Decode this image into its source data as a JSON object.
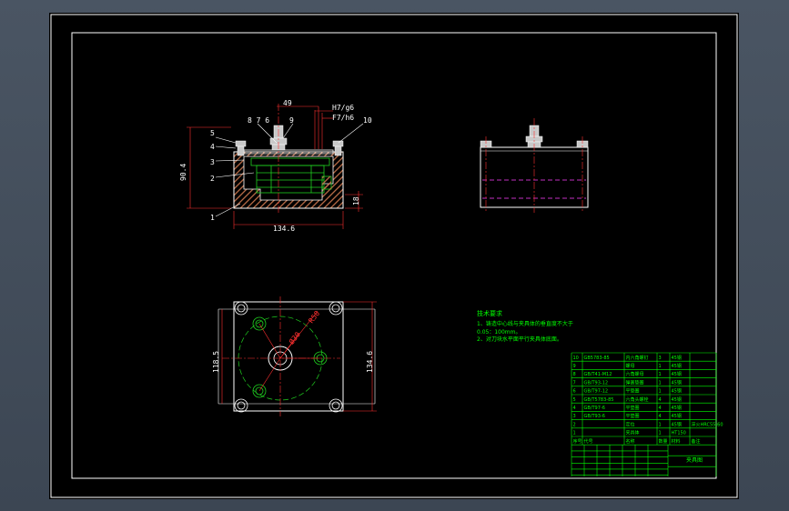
{
  "colors": {
    "background": "#4a5563",
    "sheet": "#000000",
    "outline": "#ffffff",
    "dimension": "#ff3030",
    "centerline": "#ff3030",
    "hatch": "#c0704a",
    "hidden": "#ff40ff",
    "internal": "#20d020",
    "notes": "#00ff00",
    "bolt": "#c8c8c8",
    "table": "#00ff00"
  },
  "front_view": {
    "dims": {
      "top_width": "49",
      "fit_1": "H7/g6",
      "fit_2": "F7/h6",
      "height": "90.4",
      "bottom_width": "134.6",
      "base_thickness": "18"
    },
    "balloons": {
      "b1": "1",
      "b2": "2",
      "b3": "3",
      "b4": "4",
      "b5": "5",
      "b876": "8 7 6",
      "b9": "9",
      "b10": "10"
    }
  },
  "plan_view": {
    "dims": {
      "left": "118.5",
      "right": "134.6",
      "diag1": "R50",
      "diag2": "Ø30"
    }
  },
  "notes": {
    "title": "技术要求",
    "line1": "1、铸造中心线与夹具体的垂直度不大于",
    "line2": "0.05：100mm。",
    "line3": "2、对刀块水平面平行夹具体底面。"
  },
  "bom": {
    "rows": [
      {
        "no": "10",
        "code": "GB5783-85",
        "name": "内六角螺钉",
        "qty": "3",
        "mat": "45钢",
        "note": ""
      },
      {
        "no": "9",
        "code": "",
        "name": "螺母",
        "qty": "1",
        "mat": "45钢",
        "note": ""
      },
      {
        "no": "8",
        "code": "GB/T41-M12",
        "name": "六角螺母",
        "qty": "1",
        "mat": "45钢",
        "note": ""
      },
      {
        "no": "7",
        "code": "GB/T93-12",
        "name": "弹簧垫圈",
        "qty": "1",
        "mat": "45钢",
        "note": ""
      },
      {
        "no": "6",
        "code": "GB/T97-12",
        "name": "平垫圈",
        "qty": "1",
        "mat": "45钢",
        "note": ""
      },
      {
        "no": "5",
        "code": "GB/T5783-85",
        "name": "六角头螺栓",
        "qty": "4",
        "mat": "45钢",
        "note": ""
      },
      {
        "no": "4",
        "code": "GB/T97-6",
        "name": "平垫圈",
        "qty": "4",
        "mat": "45钢",
        "note": ""
      },
      {
        "no": "3",
        "code": "GB/T93-6",
        "name": "平垫圈",
        "qty": "4",
        "mat": "45钢",
        "note": ""
      },
      {
        "no": "2",
        "code": "",
        "name": "定位",
        "qty": "1",
        "mat": "45钢",
        "note": "淬火HRC55-60"
      },
      {
        "no": "1",
        "code": "",
        "name": "夹具体",
        "qty": "1",
        "mat": "HT150",
        "note": ""
      }
    ],
    "header": {
      "no": "序号",
      "code": "代号",
      "name": "名称",
      "qty": "数量",
      "mat": "材料",
      "note": "备注"
    },
    "title_label": "夹具图"
  }
}
